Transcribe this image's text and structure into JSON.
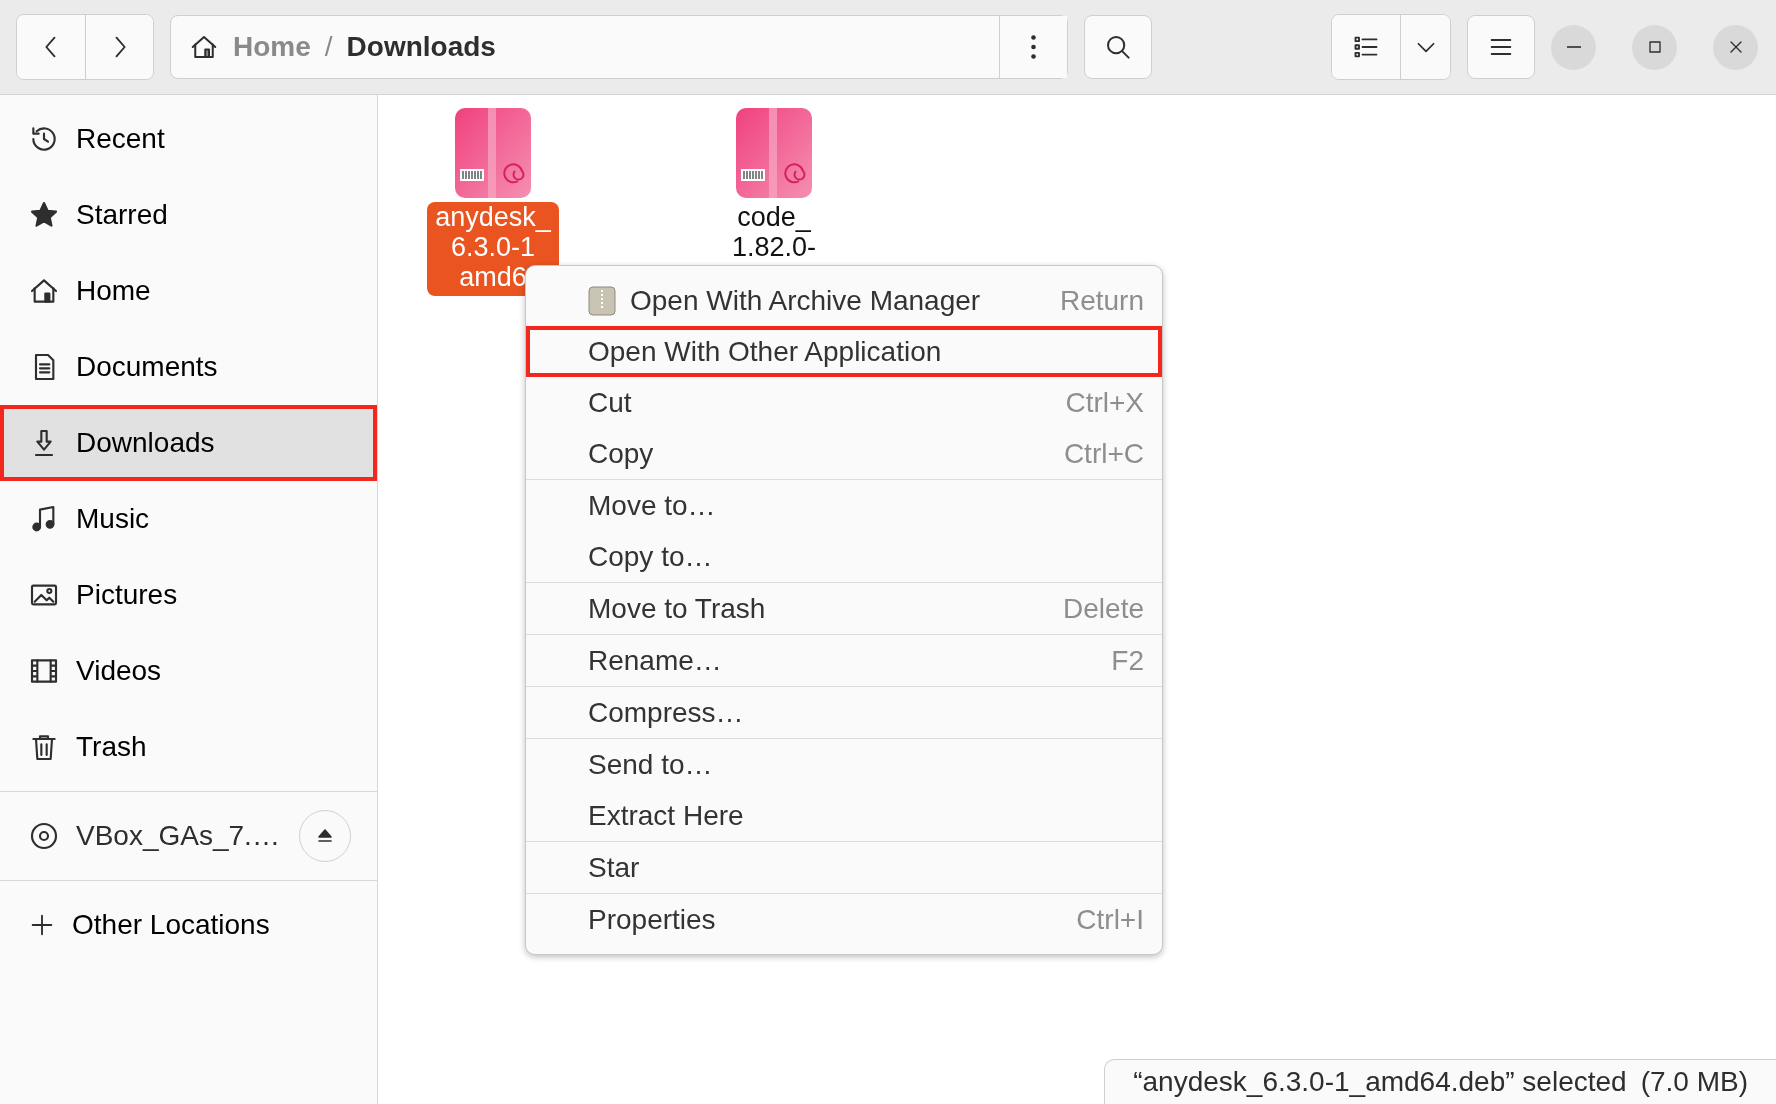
{
  "header": {
    "path": [
      {
        "label": "Home",
        "current": false
      },
      {
        "label": "Downloads",
        "current": true
      }
    ],
    "separator": "/"
  },
  "sidebar": {
    "places": [
      {
        "label": "Recent",
        "selected": false,
        "annotated": false
      },
      {
        "label": "Starred",
        "selected": false,
        "annotated": false
      },
      {
        "label": "Home",
        "selected": false,
        "annotated": false
      },
      {
        "label": "Documents",
        "selected": false,
        "annotated": false
      },
      {
        "label": "Downloads",
        "selected": true,
        "annotated": true
      },
      {
        "label": "Music",
        "selected": false,
        "annotated": false
      },
      {
        "label": "Pictures",
        "selected": false,
        "annotated": false
      },
      {
        "label": "Videos",
        "selected": false,
        "annotated": false
      },
      {
        "label": "Trash",
        "selected": false,
        "annotated": false
      }
    ],
    "devices": [
      {
        "label": "VBox_GAs_7.…",
        "selected": false
      }
    ],
    "other": {
      "label": "Other Locations"
    }
  },
  "files": [
    {
      "name_lines": [
        "anydesk_",
        "6.3.0-1",
        "amd6"
      ],
      "selected": true
    },
    {
      "name_lines": [
        "code_",
        "1.82.0-"
      ],
      "selected": false
    }
  ],
  "context_menu": {
    "groups": [
      [
        {
          "label": "Open With Archive Manager",
          "shortcut": "Return",
          "kind": "with-icon",
          "annotated": false
        },
        {
          "label": "Open With Other Application",
          "kind": "plain",
          "annotated": true
        },
        {
          "label": "Cut",
          "shortcut": "Ctrl+X",
          "kind": "plain",
          "annotated": false
        },
        {
          "label": "Copy",
          "shortcut": "Ctrl+C",
          "kind": "plain",
          "annotated": false
        }
      ],
      [
        {
          "label": "Move to…",
          "kind": "plain",
          "annotated": false
        },
        {
          "label": "Copy to…",
          "kind": "plain",
          "annotated": false
        }
      ],
      [
        {
          "label": "Move to Trash",
          "shortcut": "Delete",
          "kind": "plain",
          "annotated": false
        }
      ],
      [
        {
          "label": "Rename…",
          "shortcut": "F2",
          "kind": "plain",
          "annotated": false
        }
      ],
      [
        {
          "label": "Compress…",
          "kind": "plain",
          "annotated": false
        }
      ],
      [
        {
          "label": "Send to…",
          "kind": "plain",
          "annotated": false
        },
        {
          "label": "Extract Here",
          "kind": "plain",
          "annotated": false
        }
      ],
      [
        {
          "label": "Star",
          "kind": "plain",
          "annotated": false
        }
      ],
      [
        {
          "label": "Properties",
          "shortcut": "Ctrl+I",
          "kind": "plain",
          "annotated": false
        }
      ]
    ]
  },
  "status_bar": {
    "selection": "“anydesk_6.3.0-1_amd64.deb” selected",
    "size": "(7.0 MB)"
  }
}
